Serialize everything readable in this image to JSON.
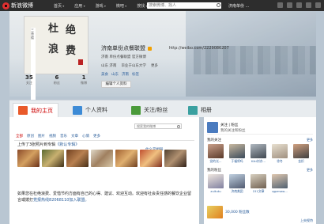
{
  "topnav": {
    "logo_text": "新浪微博",
    "links": [
      "首页",
      "应用",
      "游戏",
      "微吧",
      "搜找"
    ],
    "search_placeholder": "搜索微博、找人",
    "user_name": "济南单份 ...",
    "icons": [
      "home-icon",
      "message-icon",
      "mail-icon",
      "settings-icon",
      "user-icon"
    ]
  },
  "profile": {
    "avatar_chars": [
      "杜",
      "绝",
      "浪",
      "费"
    ],
    "avatar_side_text": "三香楼",
    "name": "济南单份点餐联盟",
    "url": "http://weibo.com/2229086207",
    "verify_text": "济南 单份点餐联盟 官方微博",
    "info": [
      "山东 济南",
      "毕业于山东大学",
      "更多"
    ],
    "tags": [
      "美食",
      "山东",
      "济南",
      "标签"
    ],
    "edit_button": "编辑个人资料",
    "stats": [
      {
        "num": "35",
        "label": "关注"
      },
      {
        "num": "6",
        "label": "粉丝"
      },
      {
        "num": "1",
        "label": "微博"
      }
    ]
  },
  "tabs": [
    {
      "label": "我的主页",
      "active": true
    },
    {
      "label": "个人资料",
      "active": false
    },
    {
      "label": "关注/粉丝",
      "active": false
    },
    {
      "label": "相册",
      "active": false
    }
  ],
  "feed": {
    "search_placeholder": "搜索我的微博",
    "filters": [
      "全部",
      "原创",
      "图片",
      "视频",
      "音乐",
      "文章",
      "心情",
      "更多"
    ],
    "whatsup_link": "什么是相册",
    "post_title_prefix": "上传了3张照片到专辑",
    "post_title_link": "《默认专辑》",
    "post_body": "如果您在杜绝浪费、爱惜节约方面有自己的心得、建议、欢迎互动。欢迎有社会责任感的餐饮企业留言或拨打",
    "post_body_link": "党报热线82068110加入联盟。"
  },
  "sidebar": {
    "head_title": "关注 | 粉丝",
    "head_sub": "我的关注和粉丝",
    "following_title": "我的关注",
    "following_more": "更多",
    "following": [
      {
        "name": "党的光..."
      },
      {
        "name": "于福将吗"
      },
      {
        "name": "Kiki刘亦..."
      },
      {
        "name": "徐冬"
      },
      {
        "name": "金炽"
      }
    ],
    "fans_title": "我的粉丝",
    "fans_more": "更多",
    "fans": [
      {
        "name": "zuitutu"
      },
      {
        "name": "济南美团"
      },
      {
        "name": "151文章"
      },
      {
        "name": "qgzmwo..."
      }
    ],
    "fan_count_label": "粉丝数",
    "fan_count": "30,000",
    "tv_link": "上央视特"
  }
}
